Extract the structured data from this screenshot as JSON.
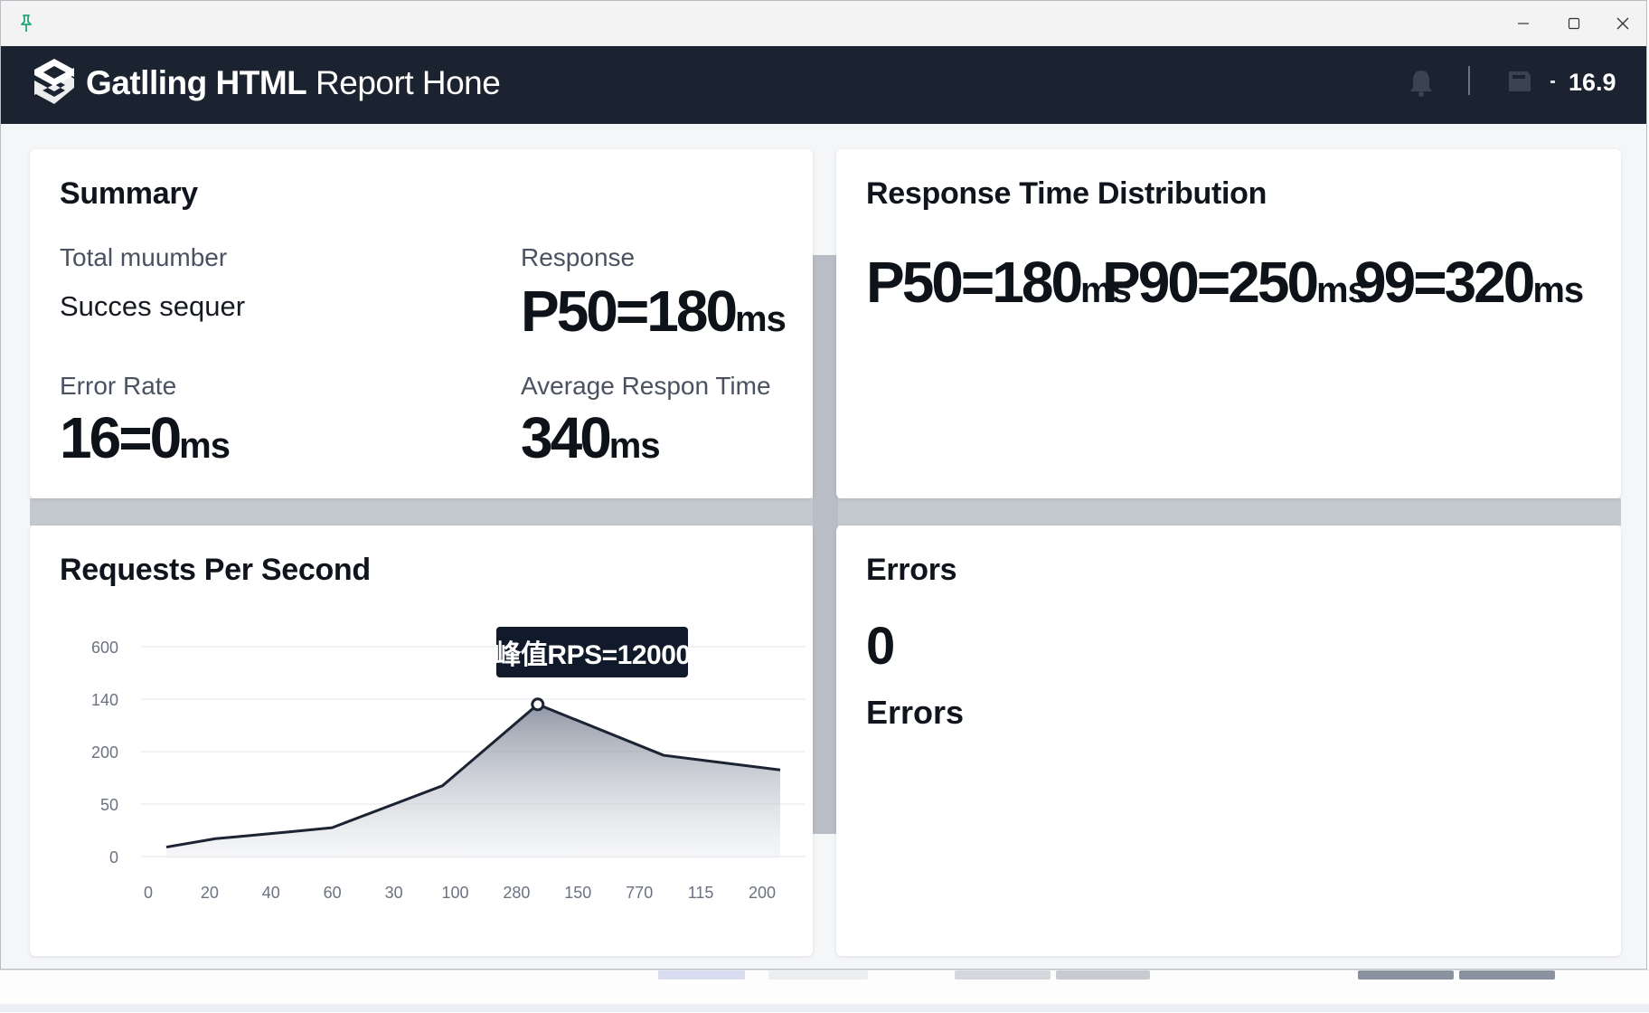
{
  "app": {
    "title_part1": "Gatlling",
    "title_part2": "HTML",
    "title_part3": "Report Hone",
    "version": "16.9"
  },
  "summary": {
    "title": "Summary",
    "total_label": "Total muumber",
    "success_label": "Succes sequer",
    "response_label": "Response",
    "response_value": "P50=180",
    "response_unit": "ms",
    "error_rate_label": "Error Rate",
    "error_rate_value": "16=0",
    "error_rate_unit": "ms",
    "avg_label": "Average Respon Time",
    "avg_value": "340",
    "avg_unit": "ms"
  },
  "distribution": {
    "title": "Response Time Distribution",
    "p50": "P50=180",
    "p90": "P90=250",
    "p99": "99=320",
    "unit": "ms"
  },
  "rps": {
    "title": "Requests Per Second",
    "tooltip": "峰值RPS=12000"
  },
  "errors": {
    "title": "Errors",
    "count": "0",
    "label": "Errors"
  },
  "chart_data": {
    "type": "area",
    "title": "Requests Per Second",
    "xlabel": "",
    "ylabel": "",
    "x_tick_labels": [
      "0",
      "20",
      "40",
      "60",
      "30",
      "100",
      "280",
      "150",
      "770",
      "115",
      "200"
    ],
    "y_tick_labels": [
      "600",
      "140",
      "200",
      "50",
      "0"
    ],
    "series": [
      {
        "values": [
          {
            "x": 0,
            "y": 0.18
          },
          {
            "x": 0.8,
            "y": 0.34
          },
          {
            "x": 2.0,
            "y": 0.47
          },
          {
            "x": 2.7,
            "y": 0.55
          },
          {
            "x": 4.5,
            "y": 1.35
          },
          {
            "x": 6.05,
            "y": 2.9
          },
          {
            "x": 8.1,
            "y": 1.93
          },
          {
            "x": 10.0,
            "y": 1.65
          }
        ]
      }
    ],
    "annotation": "峰值RPS=12000",
    "grid": true,
    "accent_color": "#1c2433"
  }
}
